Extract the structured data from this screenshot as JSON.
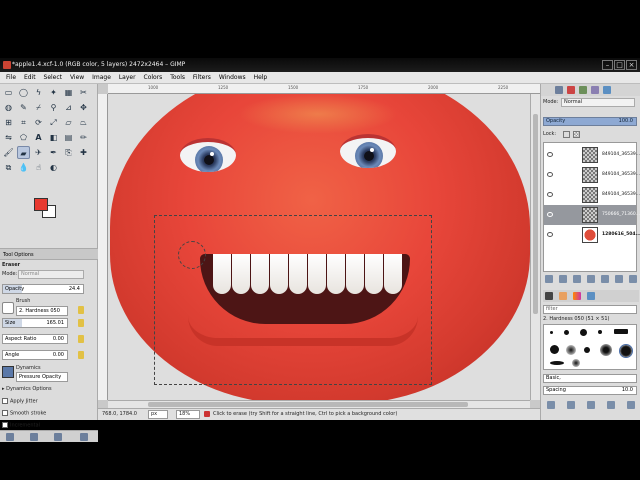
{
  "window": {
    "title": "*apple1.4.xcf-1.0 (RGB color, 5 layers) 2472x2464 – GIMP"
  },
  "menu": [
    "File",
    "Edit",
    "Select",
    "View",
    "Image",
    "Layer",
    "Colors",
    "Tools",
    "Filters",
    "Windows",
    "Help"
  ],
  "toolbox": {
    "tools": [
      "rect-select",
      "ellipse-select",
      "free-select",
      "fuzzy-select",
      "by-color-select",
      "scissors",
      "foreground-select",
      "paths",
      "color-picker",
      "zoom",
      "measure",
      "move",
      "align",
      "crop",
      "rotate",
      "scale",
      "shear",
      "perspective",
      "flip",
      "cage",
      "text",
      "bucket-fill",
      "blend",
      "pencil",
      "paintbrush",
      "eraser",
      "airbrush",
      "ink",
      "clone",
      "heal",
      "perspective-clone",
      "blur",
      "smudge",
      "dodge"
    ],
    "selected_tool": "eraser",
    "fg_color": "#e8392f",
    "bg_color": "#ffffff"
  },
  "tool_options": {
    "panel_title": "Tool Options",
    "tool_name": "Eraser",
    "mode_label": "Mode:",
    "mode_value": "Normal",
    "opacity_label": "Opacity",
    "opacity_value": "24.4",
    "brush_label": "Brush",
    "brush_value": "2. Hardness 050",
    "size_label": "Size",
    "size_value": "165.01",
    "aspect_label": "Aspect Ratio",
    "aspect_value": "0.00",
    "angle_label": "Angle",
    "angle_value": "0.00",
    "dynamics_label": "Dynamics",
    "dynamics_value": "Pressure Opacity",
    "dynamics_options": "Dynamics Options",
    "apply_jitter": "Apply Jitter",
    "smooth_stroke": "Smooth stroke",
    "incremental": "Incremental"
  },
  "ruler": {
    "ticks": [
      "1000",
      "1250",
      "1500",
      "1750",
      "2000",
      "2250"
    ]
  },
  "statusbar": {
    "coords": "768.0, 1784.0",
    "unit": "px",
    "zoom": "18%",
    "message": "Click to erase (try Shift for a straight line, Ctrl to pick a background color)"
  },
  "layers": {
    "mode_label": "Mode:",
    "mode_value": "Normal",
    "opacity_label": "Opacity",
    "opacity_value": "100.0",
    "lock_label": "Lock:",
    "items": [
      {
        "name": "849104_36539...",
        "selected": false,
        "thumb": "checker"
      },
      {
        "name": "849104_36539...",
        "selected": false,
        "thumb": "checker"
      },
      {
        "name": "849104_36539...",
        "selected": false,
        "thumb": "checker"
      },
      {
        "name": "750666_71360...",
        "selected": true,
        "thumb": "checker"
      },
      {
        "name": "1280616_504...",
        "selected": false,
        "thumb": "apple"
      }
    ]
  },
  "brushes": {
    "filter_placeholder": "filter",
    "current": "2. Hardness 050 (51 × 51)",
    "tag_field": "Basic,",
    "spacing_label": "Spacing",
    "spacing_value": "10.0"
  }
}
